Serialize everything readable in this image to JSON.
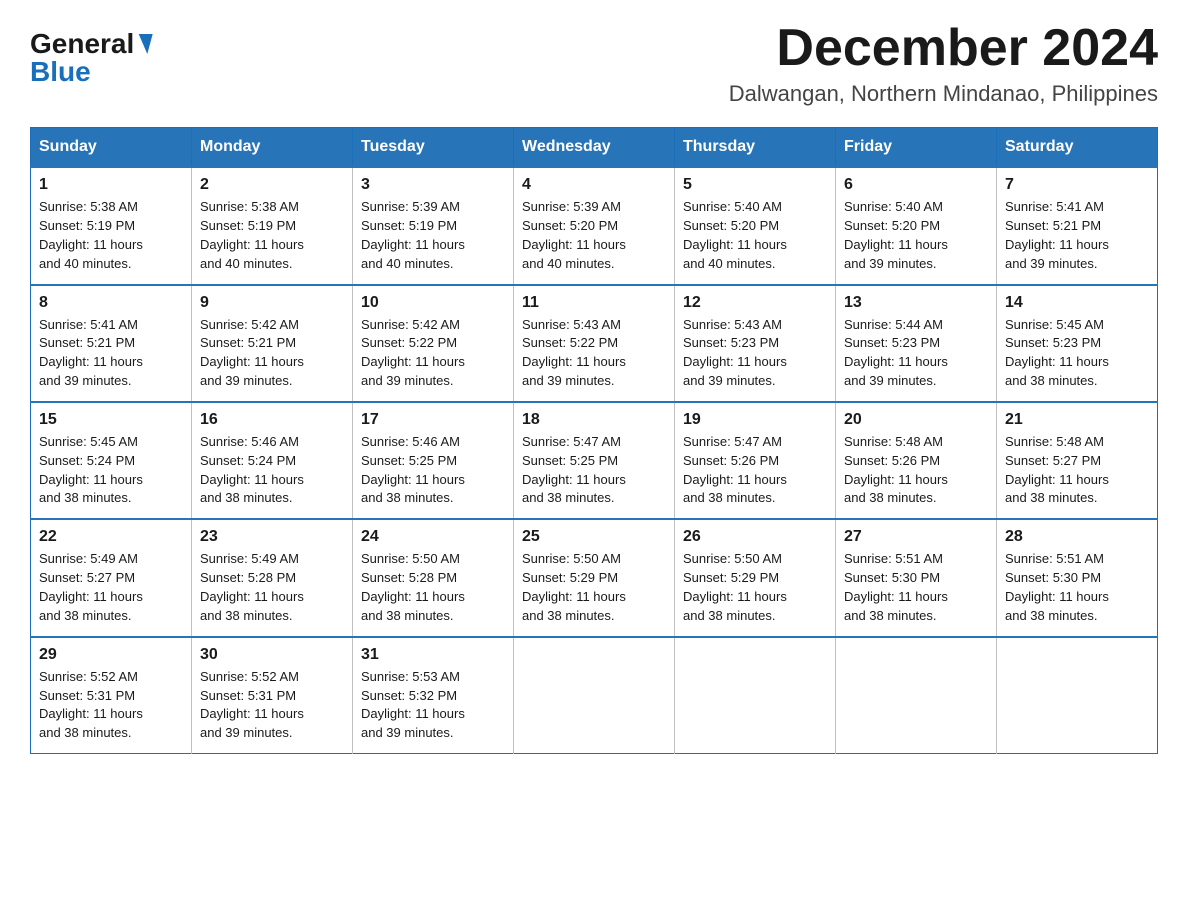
{
  "logo": {
    "general": "General",
    "blue": "Blue"
  },
  "title": {
    "month": "December 2024",
    "location": "Dalwangan, Northern Mindanao, Philippines"
  },
  "headers": [
    "Sunday",
    "Monday",
    "Tuesday",
    "Wednesday",
    "Thursday",
    "Friday",
    "Saturday"
  ],
  "weeks": [
    [
      {
        "day": "1",
        "sunrise": "5:38 AM",
        "sunset": "5:19 PM",
        "daylight": "11 hours and 40 minutes."
      },
      {
        "day": "2",
        "sunrise": "5:38 AM",
        "sunset": "5:19 PM",
        "daylight": "11 hours and 40 minutes."
      },
      {
        "day": "3",
        "sunrise": "5:39 AM",
        "sunset": "5:19 PM",
        "daylight": "11 hours and 40 minutes."
      },
      {
        "day": "4",
        "sunrise": "5:39 AM",
        "sunset": "5:20 PM",
        "daylight": "11 hours and 40 minutes."
      },
      {
        "day": "5",
        "sunrise": "5:40 AM",
        "sunset": "5:20 PM",
        "daylight": "11 hours and 40 minutes."
      },
      {
        "day": "6",
        "sunrise": "5:40 AM",
        "sunset": "5:20 PM",
        "daylight": "11 hours and 39 minutes."
      },
      {
        "day": "7",
        "sunrise": "5:41 AM",
        "sunset": "5:21 PM",
        "daylight": "11 hours and 39 minutes."
      }
    ],
    [
      {
        "day": "8",
        "sunrise": "5:41 AM",
        "sunset": "5:21 PM",
        "daylight": "11 hours and 39 minutes."
      },
      {
        "day": "9",
        "sunrise": "5:42 AM",
        "sunset": "5:21 PM",
        "daylight": "11 hours and 39 minutes."
      },
      {
        "day": "10",
        "sunrise": "5:42 AM",
        "sunset": "5:22 PM",
        "daylight": "11 hours and 39 minutes."
      },
      {
        "day": "11",
        "sunrise": "5:43 AM",
        "sunset": "5:22 PM",
        "daylight": "11 hours and 39 minutes."
      },
      {
        "day": "12",
        "sunrise": "5:43 AM",
        "sunset": "5:23 PM",
        "daylight": "11 hours and 39 minutes."
      },
      {
        "day": "13",
        "sunrise": "5:44 AM",
        "sunset": "5:23 PM",
        "daylight": "11 hours and 39 minutes."
      },
      {
        "day": "14",
        "sunrise": "5:45 AM",
        "sunset": "5:23 PM",
        "daylight": "11 hours and 38 minutes."
      }
    ],
    [
      {
        "day": "15",
        "sunrise": "5:45 AM",
        "sunset": "5:24 PM",
        "daylight": "11 hours and 38 minutes."
      },
      {
        "day": "16",
        "sunrise": "5:46 AM",
        "sunset": "5:24 PM",
        "daylight": "11 hours and 38 minutes."
      },
      {
        "day": "17",
        "sunrise": "5:46 AM",
        "sunset": "5:25 PM",
        "daylight": "11 hours and 38 minutes."
      },
      {
        "day": "18",
        "sunrise": "5:47 AM",
        "sunset": "5:25 PM",
        "daylight": "11 hours and 38 minutes."
      },
      {
        "day": "19",
        "sunrise": "5:47 AM",
        "sunset": "5:26 PM",
        "daylight": "11 hours and 38 minutes."
      },
      {
        "day": "20",
        "sunrise": "5:48 AM",
        "sunset": "5:26 PM",
        "daylight": "11 hours and 38 minutes."
      },
      {
        "day": "21",
        "sunrise": "5:48 AM",
        "sunset": "5:27 PM",
        "daylight": "11 hours and 38 minutes."
      }
    ],
    [
      {
        "day": "22",
        "sunrise": "5:49 AM",
        "sunset": "5:27 PM",
        "daylight": "11 hours and 38 minutes."
      },
      {
        "day": "23",
        "sunrise": "5:49 AM",
        "sunset": "5:28 PM",
        "daylight": "11 hours and 38 minutes."
      },
      {
        "day": "24",
        "sunrise": "5:50 AM",
        "sunset": "5:28 PM",
        "daylight": "11 hours and 38 minutes."
      },
      {
        "day": "25",
        "sunrise": "5:50 AM",
        "sunset": "5:29 PM",
        "daylight": "11 hours and 38 minutes."
      },
      {
        "day": "26",
        "sunrise": "5:50 AM",
        "sunset": "5:29 PM",
        "daylight": "11 hours and 38 minutes."
      },
      {
        "day": "27",
        "sunrise": "5:51 AM",
        "sunset": "5:30 PM",
        "daylight": "11 hours and 38 minutes."
      },
      {
        "day": "28",
        "sunrise": "5:51 AM",
        "sunset": "5:30 PM",
        "daylight": "11 hours and 38 minutes."
      }
    ],
    [
      {
        "day": "29",
        "sunrise": "5:52 AM",
        "sunset": "5:31 PM",
        "daylight": "11 hours and 38 minutes."
      },
      {
        "day": "30",
        "sunrise": "5:52 AM",
        "sunset": "5:31 PM",
        "daylight": "11 hours and 39 minutes."
      },
      {
        "day": "31",
        "sunrise": "5:53 AM",
        "sunset": "5:32 PM",
        "daylight": "11 hours and 39 minutes."
      },
      null,
      null,
      null,
      null
    ]
  ],
  "labels": {
    "sunrise": "Sunrise:",
    "sunset": "Sunset:",
    "daylight": "Daylight:"
  }
}
